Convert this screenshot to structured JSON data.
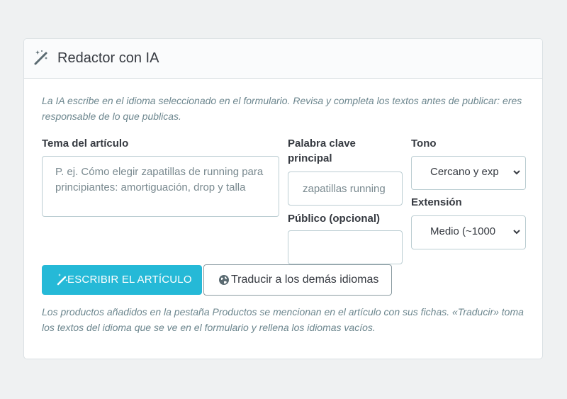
{
  "panel": {
    "title": "Redactor con IA",
    "icon": "magic-wand-icon"
  },
  "intro_text": "La IA escribe en el idioma seleccionado en el formulario. Revisa y completa los textos antes de publicar: eres responsable de lo que publicas.",
  "fields": {
    "topic": {
      "label": "Tema del artículo",
      "placeholder": "P. ej. Cómo elegir zapatillas de running para principiantes: amortiguación, drop y talla",
      "value": ""
    },
    "keyword": {
      "label": "Palabra clave principal",
      "placeholder": "zapatillas running",
      "value": ""
    },
    "audience": {
      "label": "Público (opcional)",
      "placeholder": "",
      "value": ""
    },
    "tone": {
      "label": "Tono",
      "selected": "Cercano y exp"
    },
    "length": {
      "label": "Extensión",
      "selected": "Medio (~1000"
    }
  },
  "buttons": {
    "write": "Escribir el artículo",
    "translate": "Traducir a los demás idiomas"
  },
  "footer_note": "Los productos añadidos en la pestaña Productos se mencionan en el artículo con sus fichas. «Traducir» toma los textos del idioma que se ve en el formulario y rellena los idiomas vacíos.",
  "colors": {
    "primary": "#25b9d7",
    "muted_text": "#6c868e",
    "border": "#bbcdd2"
  }
}
